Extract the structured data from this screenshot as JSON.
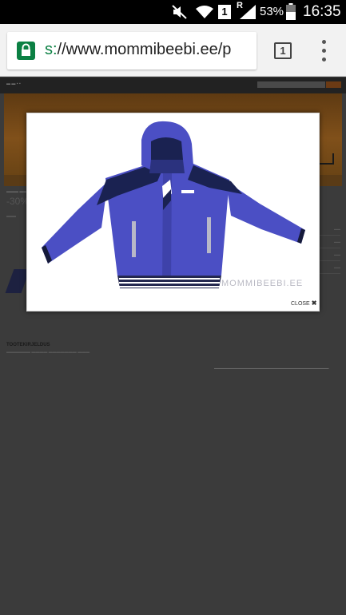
{
  "status_bar": {
    "battery_percent": "53%",
    "time": "16:35",
    "sim_indicator": "1",
    "roaming_indicator": "R",
    "icons": [
      "mute-icon",
      "wifi-icon",
      "sim-icon",
      "signal-icon",
      "battery-icon"
    ]
  },
  "browser": {
    "url_scheme": "s:",
    "url_rest": "//www.mommibeebi.ee/p",
    "tab_count": "1",
    "secure_color": "#0b8043"
  },
  "lightbox": {
    "watermark": "MOMMIBEEBI.EE",
    "close_label": "CLOSE",
    "close_icon": "✖",
    "jacket_color": "#4b4fc4"
  },
  "site": {
    "discount": "-30%",
    "description_title": "TOOTEKIRJELDUS"
  }
}
